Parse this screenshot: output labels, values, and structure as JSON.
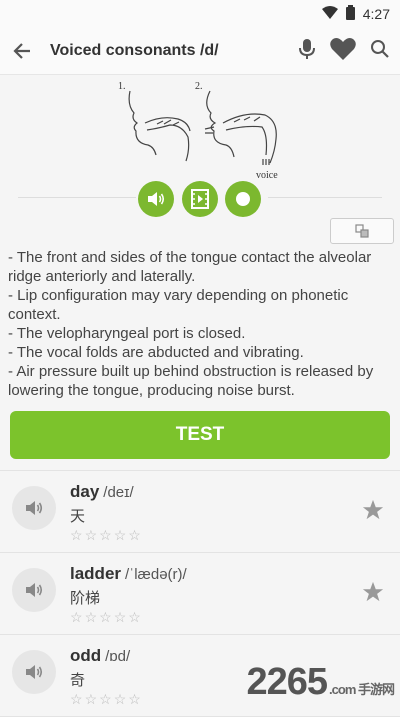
{
  "status": {
    "time": "4:27"
  },
  "appbar": {
    "title": "Voiced consonants /d/"
  },
  "illustration": {
    "label1": "1.",
    "label2": "2.",
    "voice_label": "voice"
  },
  "description": [
    "- The front and sides of the tongue contact the alveolar ridge anteriorly and laterally.",
    "- Lip configuration may vary depending on phonetic context.",
    "- The velopharyngeal port is closed.",
    "- The vocal folds are abducted and vibrating.",
    "- Air pressure built up behind obstruction is released by lowering the tongue, producing noise burst."
  ],
  "test_button": "TEST",
  "words": [
    {
      "word": "day",
      "ipa": "/deɪ/",
      "zh": "天",
      "rating": 0
    },
    {
      "word": "ladder",
      "ipa": "/ˈlædə(r)/",
      "zh": "阶梯",
      "rating": 0
    },
    {
      "word": "odd",
      "ipa": "/ɒd/",
      "zh": "奇",
      "rating": 0
    }
  ],
  "colors": {
    "accent": "#7cc32c",
    "media_button": "#7cb82f"
  },
  "watermark": {
    "main": "2265",
    "sub": ".com 手游网"
  }
}
